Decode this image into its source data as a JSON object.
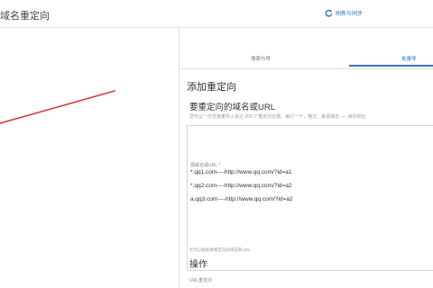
{
  "header": {
    "title": "域名重定向",
    "refresh_label": "刷新与同步",
    "accent": "#3375c4"
  },
  "tabs": [
    {
      "label": "搜索与导"
    },
    {
      "label": "批量导"
    }
  ],
  "panel": {
    "title": "添加重定向",
    "subtitle": "要重定向的域名或URL",
    "description": "您可以一次性批量导入多达 200 个重定向记录。每行一个，格式：来源域名 ---- 目标地址",
    "input_label": "源域名或URL *",
    "lines": [
      "*.qq1.com----http://www.qq.com/?id=a1",
      "*.qq2.com----http://www.qq.com/?id=a2",
      "a.qq3.com----http://www.qq.com/?id=a2"
    ],
    "hint": "您可以粘贴要重定向的域名和URL",
    "ops_title": "操作",
    "url_label": "URL重定向"
  },
  "annotation": {
    "arrow_color": "#d93a3a"
  }
}
